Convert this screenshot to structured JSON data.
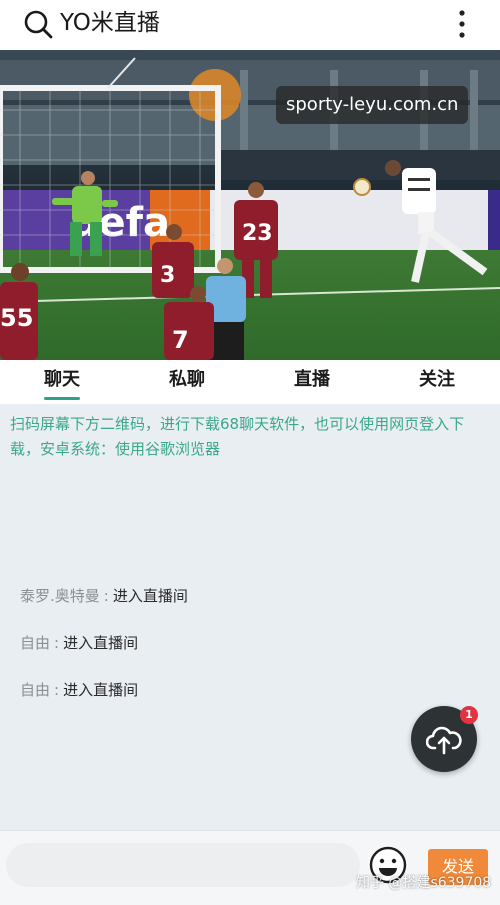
{
  "header": {
    "title": "YO米直播",
    "search_icon": "search-icon",
    "menu_icon": "more-vertical-icon"
  },
  "video": {
    "watermark": "sporty-leyu.com.cn",
    "scene": "football-match-header",
    "player_numbers": [
      "55",
      "3",
      "23",
      "7"
    ],
    "board_text": "uefa"
  },
  "tabs": [
    {
      "label": "聊天",
      "active": true
    },
    {
      "label": "私聊",
      "active": false
    },
    {
      "label": "直播",
      "active": false
    },
    {
      "label": "关注",
      "active": false
    }
  ],
  "notice": "扫码屏幕下方二维码，进行下载68聊天软件，也可以使用网页登入下载，安卓系统：使用谷歌浏览器",
  "messages": [
    {
      "user": "泰罗.奥特曼",
      "text": "进入直播间"
    },
    {
      "user": "自由",
      "text": "进入直播间"
    },
    {
      "user": "自由",
      "text": "进入直播间"
    }
  ],
  "fab": {
    "icon": "cloud-upload-icon",
    "badge": "1"
  },
  "composer": {
    "placeholder": "",
    "emoji_icon": "emoji-icon",
    "send_label": "发送"
  },
  "watermark_bottom": "知乎 @搭建s639708",
  "colors": {
    "accent": "#2aa18a",
    "notice": "#3aa889",
    "send": "#f08a3a",
    "badge": "#e4333f"
  }
}
